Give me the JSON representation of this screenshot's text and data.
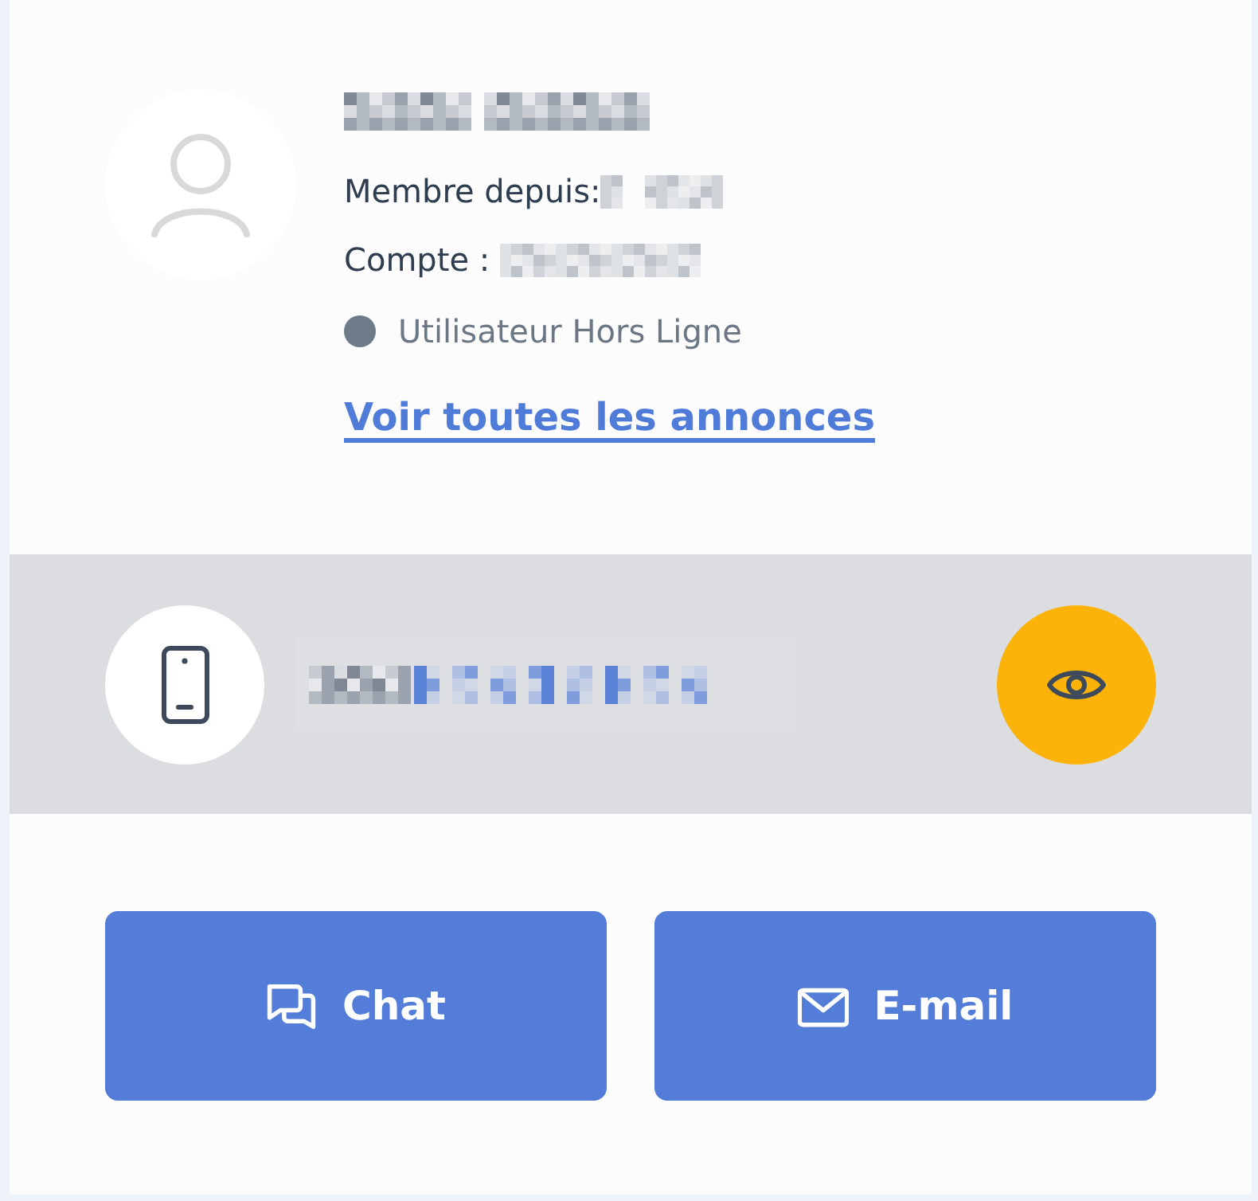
{
  "profile": {
    "member_since_label": "Membre depuis:",
    "account_label": "Compte :",
    "status": {
      "text": "Utilisateur Hors Ligne",
      "online": false
    },
    "link": "Voir toutes les annonces"
  },
  "buttons": [
    {
      "kind": "chat",
      "label": "Chat"
    },
    {
      "kind": "email",
      "label": "E-mail"
    }
  ]
}
